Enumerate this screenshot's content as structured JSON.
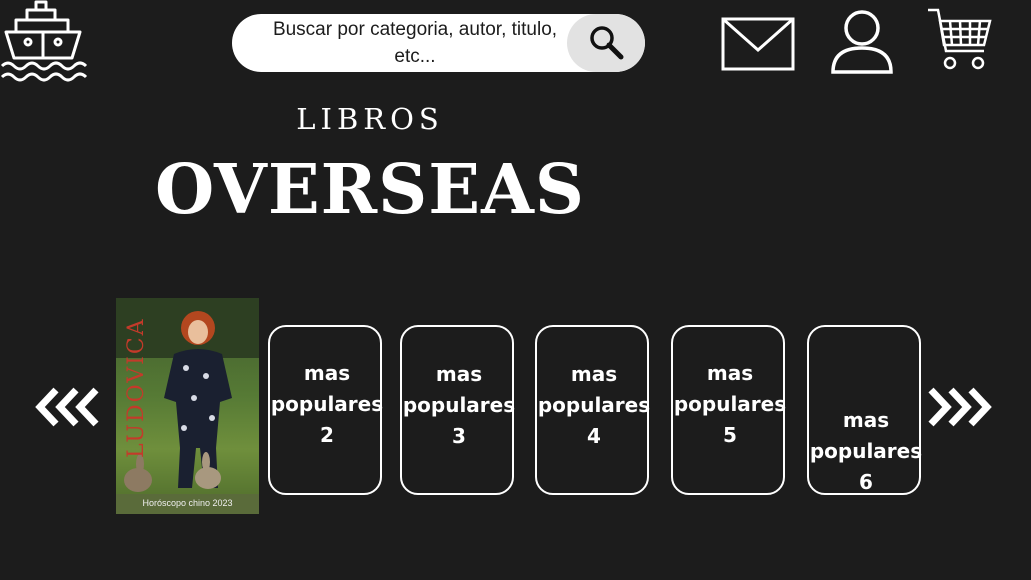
{
  "header": {
    "logo_icon": "ship-icon",
    "search": {
      "placeholder": "Buscar por categoria, autor, titulo, etc...",
      "button_icon": "search-icon"
    },
    "icons": [
      "mail-icon",
      "user-icon",
      "cart-icon"
    ]
  },
  "hero": {
    "subtitle": "LIBROS",
    "title": "OVERSEAS"
  },
  "carousel": {
    "prev_icon": "triple-chevron-left-icon",
    "next_icon": "triple-chevron-right-icon",
    "featured_book": {
      "author": "LUDOVICA",
      "caption": "Horóscopo chino 2023"
    },
    "cards": [
      {
        "label": "mas\npopulares\n2"
      },
      {
        "label": "mas\npopulares\n3"
      },
      {
        "label": "mas\npopulares\n4"
      },
      {
        "label": "mas\npopulares\n5"
      },
      {
        "label": "mas\npopulares\n6"
      }
    ]
  },
  "colors": {
    "background": "#1c1c1c",
    "foreground": "#ffffff",
    "search_button": "#e2e2e2"
  }
}
